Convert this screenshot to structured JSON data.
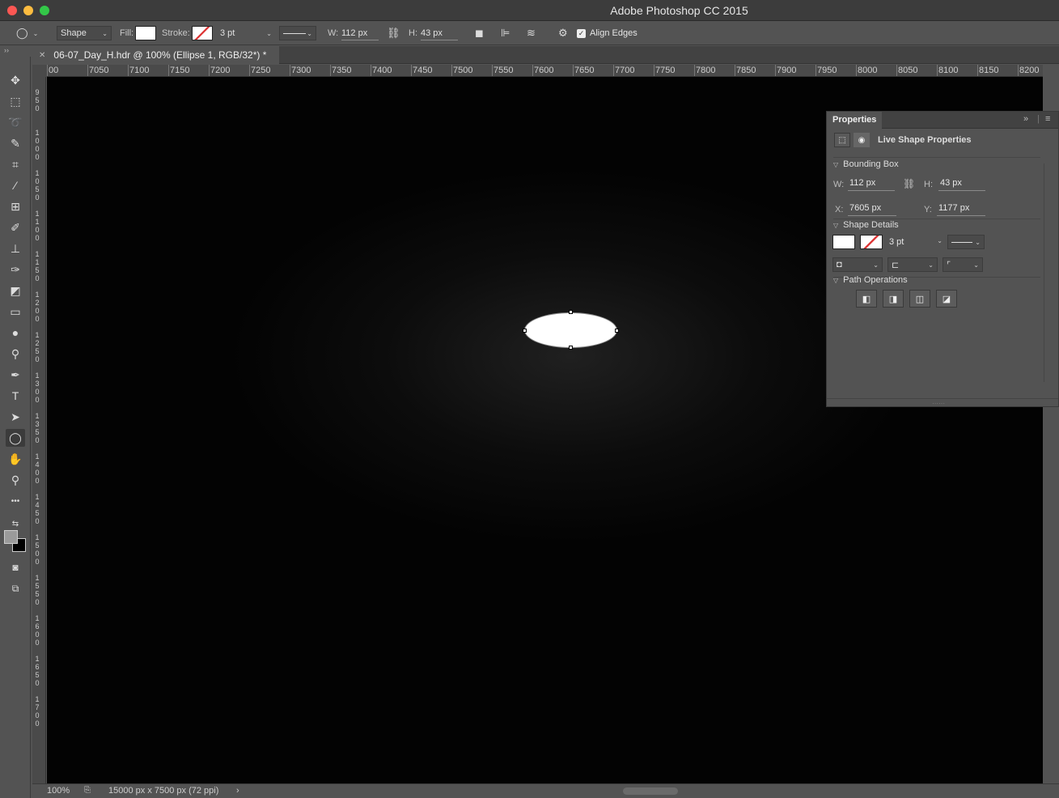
{
  "window": {
    "app_title": "Adobe Photoshop CC 2015"
  },
  "options_bar": {
    "tool_mode": "Shape",
    "fill_label": "Fill:",
    "stroke_label": "Stroke:",
    "stroke_width": "3 pt",
    "w_label": "W:",
    "w_value": "112 px",
    "h_label": "H:",
    "h_value": "43 px",
    "align_edges_label": "Align Edges",
    "align_edges_checked": true,
    "fill_color": "#ffffff"
  },
  "document": {
    "tab_title": "06-07_Day_H.hdr @ 100% (Ellipse 1, RGB/32*) *",
    "zoom": "100%",
    "doc_info": "15000 px x 7500 px (72 ppi)"
  },
  "ruler": {
    "h_ticks": [
      "00",
      "7050",
      "7100",
      "7150",
      "7200",
      "7250",
      "7300",
      "7350",
      "7400",
      "7450",
      "7500",
      "7550",
      "7600",
      "7650",
      "7700",
      "7750",
      "7800",
      "7850",
      "7900",
      "7950",
      "8000",
      "8050",
      "8100",
      "8150",
      "8200"
    ],
    "v_ticks": [
      "9\n5\n0",
      "1\n0\n0\n0",
      "1\n0\n5\n0",
      "1\n1\n0\n0",
      "1\n1\n5\n0",
      "1\n2\n0\n0",
      "1\n2\n5\n0",
      "1\n3\n0\n0",
      "1\n3\n5\n0",
      "1\n4\n0\n0",
      "1\n4\n5\n0",
      "1\n5\n0\n0",
      "1\n5\n5\n0",
      "1\n6\n0\n0",
      "1\n6\n5\n0",
      "1\n7\n0\n0"
    ]
  },
  "tools": [
    {
      "name": "move-tool",
      "glyph": "✥"
    },
    {
      "name": "marquee-tool",
      "glyph": "⬚"
    },
    {
      "name": "lasso-tool",
      "glyph": "➰"
    },
    {
      "name": "quick-select-tool",
      "glyph": "✎"
    },
    {
      "name": "crop-tool",
      "glyph": "⌗"
    },
    {
      "name": "eyedropper-tool",
      "glyph": "⁄"
    },
    {
      "name": "frame-tool",
      "glyph": "⊞"
    },
    {
      "name": "brush-tool",
      "glyph": "✐"
    },
    {
      "name": "stamp-tool",
      "glyph": "⊥"
    },
    {
      "name": "history-brush-tool",
      "glyph": "✑"
    },
    {
      "name": "eraser-tool",
      "glyph": "◩"
    },
    {
      "name": "gradient-tool",
      "glyph": "▭"
    },
    {
      "name": "blur-tool",
      "glyph": "●"
    },
    {
      "name": "dodge-tool",
      "glyph": "⚲"
    },
    {
      "name": "pen-tool",
      "glyph": "✒"
    },
    {
      "name": "type-tool",
      "glyph": "T"
    },
    {
      "name": "path-select-tool",
      "glyph": "➤"
    },
    {
      "name": "ellipse-tool",
      "glyph": "◯"
    },
    {
      "name": "hand-tool",
      "glyph": "✋"
    },
    {
      "name": "zoom-tool",
      "glyph": "⚲"
    },
    {
      "name": "more-tools",
      "glyph": "•••"
    }
  ],
  "properties": {
    "tab_label": "Properties",
    "subtitle": "Live Shape Properties",
    "bounding_box_label": "Bounding Box",
    "w_label": "W:",
    "w_value": "112 px",
    "h_label": "H:",
    "h_value": "43 px",
    "x_label": "X:",
    "x_value": "7605 px",
    "y_label": "Y:",
    "y_value": "1177 px",
    "shape_details_label": "Shape Details",
    "stroke_width": "3 pt",
    "path_operations_label": "Path Operations"
  }
}
